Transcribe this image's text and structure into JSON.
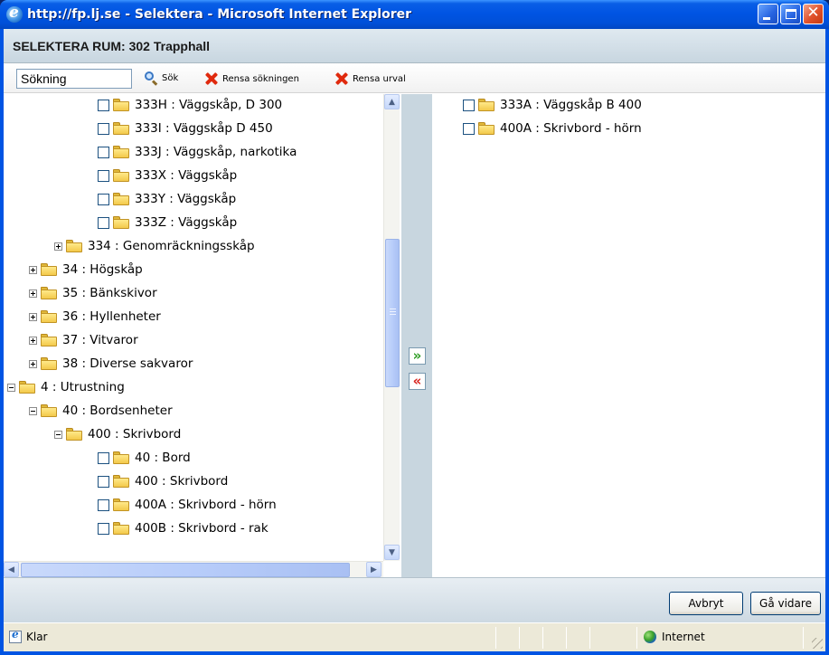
{
  "window": {
    "title": "http://fp.lj.se - Selektera - Microsoft Internet Explorer"
  },
  "header": {
    "title": "SELEKTERA RUM: 302 Trapphall"
  },
  "toolbar": {
    "search_value": "Sökning",
    "search_label": "Sök",
    "clear_search_label": "Rensa sökningen",
    "clear_selection_label": "Rensa urval"
  },
  "tree": {
    "items": [
      {
        "label": "333H : Väggskåp, D 300",
        "level": 3,
        "kind": "checkbox"
      },
      {
        "label": "333I : Väggskåp D 450",
        "level": 3,
        "kind": "checkbox"
      },
      {
        "label": "333J : Väggskåp, narkotika",
        "level": 3,
        "kind": "checkbox"
      },
      {
        "label": "333X : Väggskåp",
        "level": 3,
        "kind": "checkbox"
      },
      {
        "label": "333Y : Väggskåp",
        "level": 3,
        "kind": "checkbox"
      },
      {
        "label": "333Z : Väggskåp",
        "level": 3,
        "kind": "checkbox"
      },
      {
        "label": "334 : Genomräckningsskåp",
        "level": 2,
        "kind": "plus"
      },
      {
        "label": "34 : Högskåp",
        "level": 1,
        "kind": "plus"
      },
      {
        "label": "35 : Bänkskivor",
        "level": 1,
        "kind": "plus"
      },
      {
        "label": "36 : Hyllenheter",
        "level": 1,
        "kind": "plus"
      },
      {
        "label": "37 : Vitvaror",
        "level": 1,
        "kind": "plus"
      },
      {
        "label": "38 : Diverse sakvaror",
        "level": 1,
        "kind": "plus"
      },
      {
        "label": "4 : Utrustning",
        "level": 0,
        "kind": "minus"
      },
      {
        "label": "40 : Bordsenheter",
        "level": 1,
        "kind": "minus"
      },
      {
        "label": "400 : Skrivbord",
        "level": 2,
        "kind": "minus"
      },
      {
        "label": "40 : Bord",
        "level": 3,
        "kind": "checkbox"
      },
      {
        "label": "400 : Skrivbord",
        "level": 3,
        "kind": "checkbox"
      },
      {
        "label": "400A : Skrivbord - hörn",
        "level": 3,
        "kind": "checkbox"
      },
      {
        "label": "400B : Skrivbord - rak",
        "level": 3,
        "kind": "checkbox"
      }
    ]
  },
  "transfer": {
    "add_glyph": "»",
    "remove_glyph": "«"
  },
  "selected": {
    "items": [
      {
        "label": "333A : Väggskåp B 400"
      },
      {
        "label": "400A : Skrivbord - hörn"
      }
    ]
  },
  "footer": {
    "cancel_label": "Avbryt",
    "next_label": "Gå vidare"
  },
  "statusbar": {
    "status_text": "Klar",
    "zone_text": "Internet"
  }
}
